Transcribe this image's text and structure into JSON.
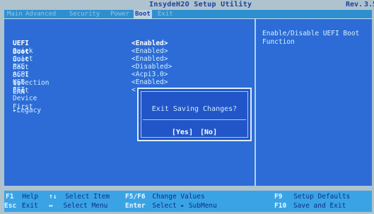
{
  "titlebar": {
    "title": "InsydeH2O Setup Utility",
    "rev_label": "Rev.",
    "rev_value": "3.5"
  },
  "tabs": [
    {
      "label": "Main",
      "active": false
    },
    {
      "label": "Advanced",
      "active": false
    },
    {
      "label": "Security",
      "active": false
    },
    {
      "label": "Power",
      "active": false
    },
    {
      "label": "Boot",
      "active": true
    },
    {
      "label": "Exit",
      "active": false
    }
  ],
  "boot_items": [
    {
      "label": "UEFI Boot",
      "value": "<Enabled>"
    },
    {
      "label": "Quick Boot",
      "value": "<Enabled>"
    },
    {
      "label": "Quiet Boot",
      "value": "<Enabled>"
    },
    {
      "label": "PXE Boot to LAN",
      "value": "<Disabled>"
    },
    {
      "label": "ACPI Selection",
      "value": "<Acpi3.0>"
    },
    {
      "label": "USB Boot",
      "value": "<Enabled>"
    },
    {
      "label": "EFI Device First",
      "value": "<"
    }
  ],
  "legacy_item": "▸Legacy",
  "help_text": "Enable/Disable UEFI Boot Function",
  "dialog": {
    "message": "Exit Saving Changes?",
    "yes": "[Yes]",
    "no": "[No]"
  },
  "footer": {
    "f1_key": "F1",
    "f1_desc": "Help",
    "esc_key": "Esc",
    "esc_desc": "Exit",
    "updown_key": "↑↓",
    "updown_desc": "Select Item",
    "leftright_key": "↔",
    "leftright_desc": "Select Menu",
    "f5f6_key": "F5/F6",
    "f5f6_desc": "Change Values",
    "enter_key": "Enter",
    "enter_desc": "Select ▸ SubMenu",
    "f9_key": "F9",
    "f9_desc": "Setup Defaults",
    "f10_key": "F10",
    "f10_desc": "Save and Exit"
  }
}
